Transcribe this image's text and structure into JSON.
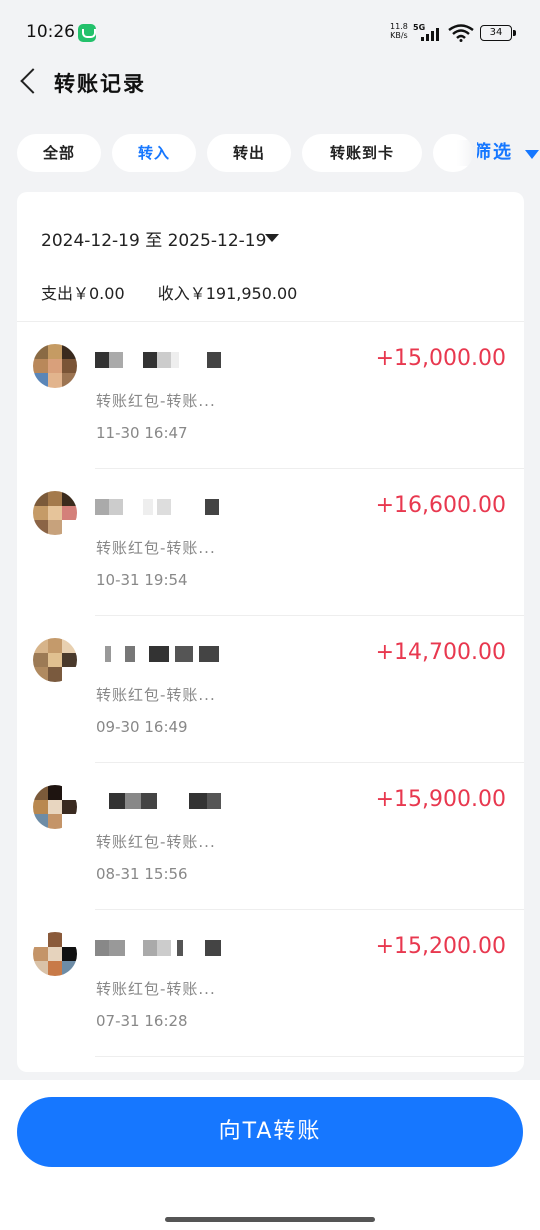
{
  "status_bar": {
    "time": "10:26",
    "net_speed_value": "11.8",
    "net_speed_unit": "KB/s",
    "net_type": "5G",
    "battery": "34"
  },
  "header": {
    "title": "转账记录"
  },
  "chips": [
    {
      "label": "全部",
      "active": false
    },
    {
      "label": "转入",
      "active": true
    },
    {
      "label": "转出",
      "active": false
    },
    {
      "label": "转账到卡",
      "active": false
    }
  ],
  "filter": {
    "label": "筛选"
  },
  "summary": {
    "date_range": "2024-12-19 至 2025-12-19",
    "expense": "支出￥0.00",
    "income": "收入￥191,950.00"
  },
  "records": [
    {
      "note": "转账红包-转账...",
      "time": "11-30 16:47",
      "amount": "+15,000.00"
    },
    {
      "note": "转账红包-转账...",
      "time": "10-31 19:54",
      "amount": "+16,600.00"
    },
    {
      "note": "转账红包-转账...",
      "time": "09-30 16:49",
      "amount": "+14,700.00"
    },
    {
      "note": "转账红包-转账...",
      "time": "08-31 15:56",
      "amount": "+15,900.00"
    },
    {
      "note": "转账红包-转账...",
      "time": "07-31 16:28",
      "amount": "+15,200.00"
    }
  ],
  "bottom": {
    "transfer_label": "向TA转账"
  },
  "colors": {
    "accent": "#1677ff",
    "income_amount": "#e8384f",
    "background": "#f2f3f5"
  }
}
